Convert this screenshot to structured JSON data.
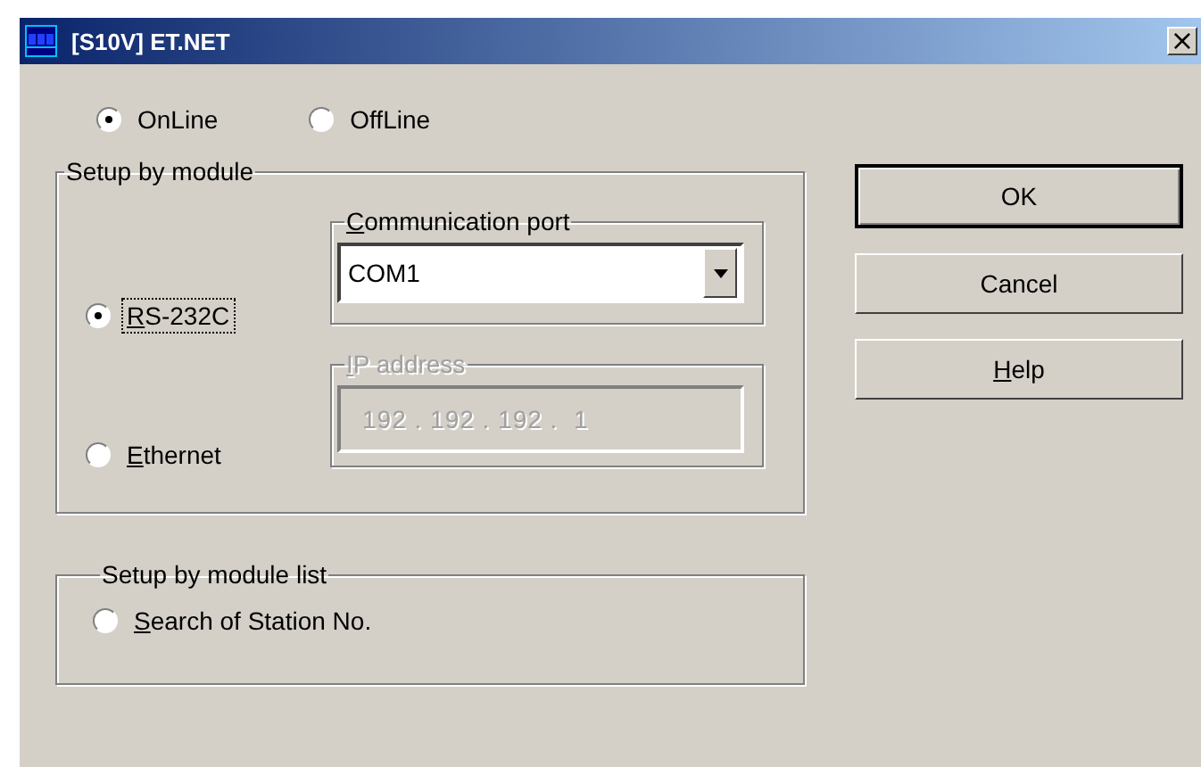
{
  "window": {
    "title": "[S10V] ET.NET",
    "close": "×"
  },
  "mode_options": [
    {
      "label": "OnLine",
      "selected": true
    },
    {
      "label": "OffLine",
      "selected": false
    }
  ],
  "setup_by_module": {
    "title": "Setup by module",
    "connections": [
      {
        "label": "RS-232C",
        "mnemonic": true,
        "selected": true,
        "focused": true
      },
      {
        "label": "Ethernet",
        "mnemonic": true,
        "selected": false,
        "focused": false
      }
    ],
    "communication_port": {
      "title": "Communication port",
      "mnemonic": true,
      "disabled": false,
      "value": "COM1"
    },
    "ip_address": {
      "title": "IP address",
      "mnemonic": true,
      "disabled": true,
      "value": "192 . 192 . 192 .  1"
    }
  },
  "setup_by_module_list": {
    "title": "Setup by module list",
    "options": [
      {
        "label": "Search of Station No.",
        "mnemonic": true,
        "selected": false
      }
    ]
  },
  "buttons": [
    {
      "label": "OK",
      "mnemonic": false,
      "default": true
    },
    {
      "label": "Cancel",
      "mnemonic": false,
      "default": false
    },
    {
      "label": "Help",
      "mnemonic": true,
      "default": false
    }
  ]
}
